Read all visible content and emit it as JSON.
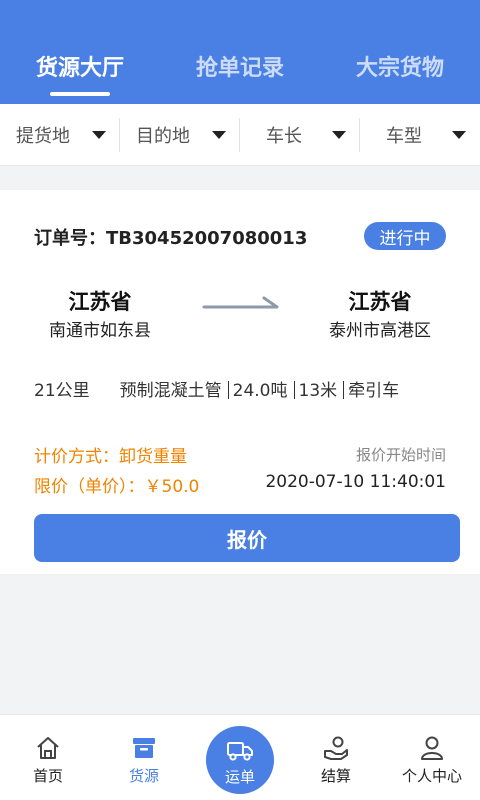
{
  "header": {
    "tabs": [
      {
        "label": "货源大厅",
        "active": true
      },
      {
        "label": "抢单记录",
        "active": false
      },
      {
        "label": "大宗货物",
        "active": false
      }
    ]
  },
  "filters": [
    {
      "label": "提货地"
    },
    {
      "label": "目的地"
    },
    {
      "label": "车长"
    },
    {
      "label": "车型"
    }
  ],
  "order": {
    "order_label": "订单号：",
    "order_number": "TB30452007080013",
    "status": "进行中",
    "origin": {
      "province": "江苏省",
      "city": "南通市如东县"
    },
    "destination": {
      "province": "江苏省",
      "city": "泰州市高港区"
    },
    "distance": "21公里",
    "cargo": "预制混凝土管",
    "weight": "24.0吨",
    "length": "13米",
    "vehicle_type": "牵引车",
    "pricing_method": "计价方式：卸货重量",
    "price_limit": "限价（单价）：￥50.0",
    "quote_start_label": "报价开始时间",
    "quote_start_time": "2020-07-10 11:40:01",
    "quote_button": "报价"
  },
  "bottom_nav": [
    {
      "label": "首页",
      "icon": "home-icon"
    },
    {
      "label": "货源",
      "icon": "box-icon",
      "active": true
    },
    {
      "label": "运单",
      "icon": "truck-icon",
      "center": true
    },
    {
      "label": "结算",
      "icon": "hand-coin-icon"
    },
    {
      "label": "个人中心",
      "icon": "user-icon"
    }
  ],
  "colors": {
    "primary": "#4a80e3",
    "accent": "#f08300",
    "background": "#f2f3f5"
  }
}
